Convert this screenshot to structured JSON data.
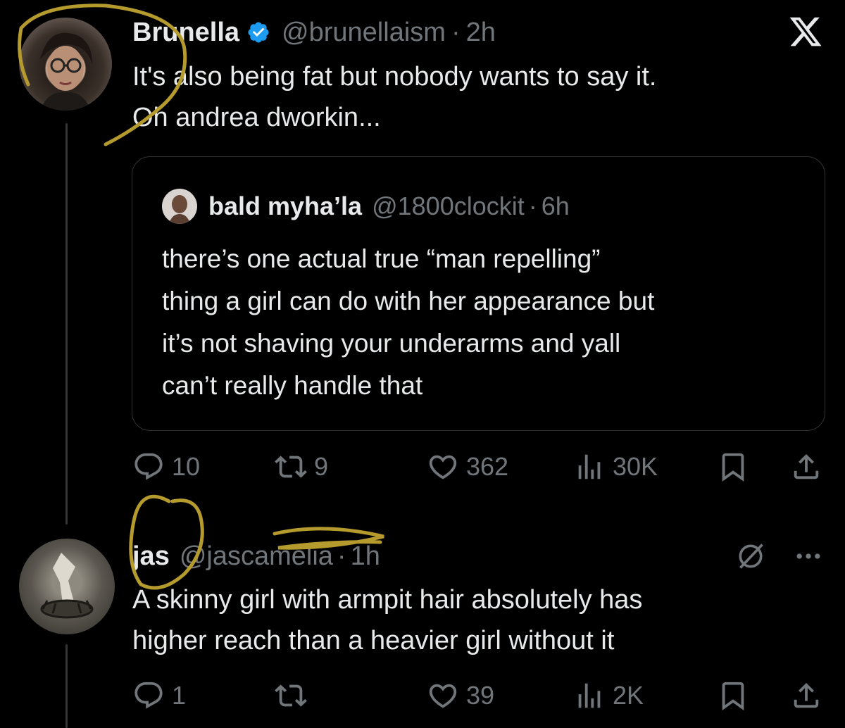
{
  "main_tweet": {
    "display_name": "Brunella",
    "handle": "@brunellaism",
    "separator": "·",
    "time": "2h",
    "text_lines": [
      "It's also being fat but nobody wants to say it.",
      "Oh andrea dworkin..."
    ],
    "verified": true,
    "quoted_tweet": {
      "display_name": "bald myha’la",
      "handle": "@1800clockit",
      "separator": "·",
      "time": "6h",
      "text_lines": [
        "there’s one actual true “man repelling”",
        "thing a girl can do with her appearance but",
        "it’s not shaving your underarms and yall",
        "can’t really handle that"
      ]
    },
    "metrics": {
      "replies": "10",
      "reposts": "9",
      "likes": "362",
      "views": "30K"
    }
  },
  "reply_tweet": {
    "display_name": "jas",
    "handle": "@jascamelia",
    "separator": "·",
    "time": "1h",
    "text_lines": [
      "A skinny girl with armpit hair absolutely has",
      "higher reach than a heavier girl without it"
    ],
    "metrics": {
      "replies": "1",
      "reposts": "",
      "likes": "39",
      "views": "2K"
    }
  },
  "icons": {
    "logo": "x-logo-icon",
    "verified": "verified-badge-icon",
    "reply": "reply-icon",
    "repost": "repost-icon",
    "like": "heart-icon",
    "views": "views-icon",
    "bookmark": "bookmark-icon",
    "share": "share-icon",
    "grok": "grok-icon",
    "more": "more-icon"
  },
  "colors": {
    "background": "#000000",
    "text": "#e7e9ea",
    "muted": "#71767b",
    "verified": "#1d9bf0",
    "annotation": "#b59a2e"
  }
}
